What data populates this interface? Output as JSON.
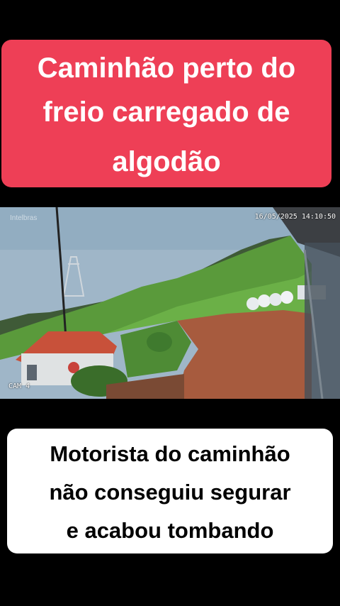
{
  "top_caption": {
    "lines": [
      "Caminhão perto do",
      "freio carregado de",
      "algodão"
    ]
  },
  "video": {
    "brand_watermark": "Intelbras",
    "timestamp": "16/05/2025 14:10:50",
    "camera_label": "CAM 4"
  },
  "bottom_caption": {
    "lines": [
      "Motorista do caminhão",
      "não conseguiu segurar",
      "e acabou tombando"
    ]
  },
  "colors": {
    "top_caption_bg": "#ee3f56",
    "bottom_caption_bg": "#ffffff",
    "page_bg": "#000000"
  }
}
